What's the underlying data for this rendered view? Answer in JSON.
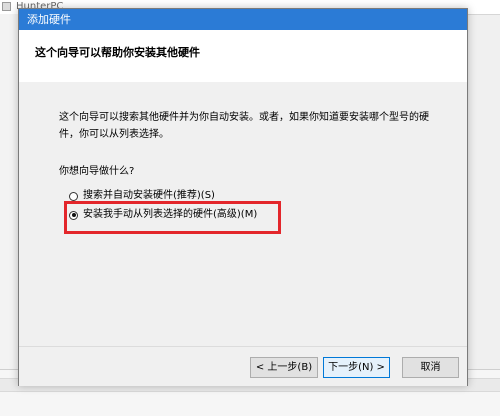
{
  "background_window": {
    "title": "HunterPC"
  },
  "dialog": {
    "title": "添加硬件",
    "header_title": "这个向导可以帮助你安装其他硬件",
    "description": "这个向导可以搜索其他硬件并为你自动安装。或者，如果你知道要安装哪个型号的硬件，你可以从列表选择。",
    "question": "你想向导做什么?",
    "options": [
      {
        "label": "搜索并自动安装硬件(推荐)(S)",
        "checked": false
      },
      {
        "label": "安装我手动从列表选择的硬件(高级)(M)",
        "checked": true
      }
    ],
    "buttons": {
      "back": "< 上一步(B)",
      "next": "下一步(N) >",
      "cancel": "取消"
    }
  },
  "colors": {
    "titlebar": "#2b7bd6",
    "highlight": "#e3262b",
    "content_bg": "#f0f0f0"
  }
}
